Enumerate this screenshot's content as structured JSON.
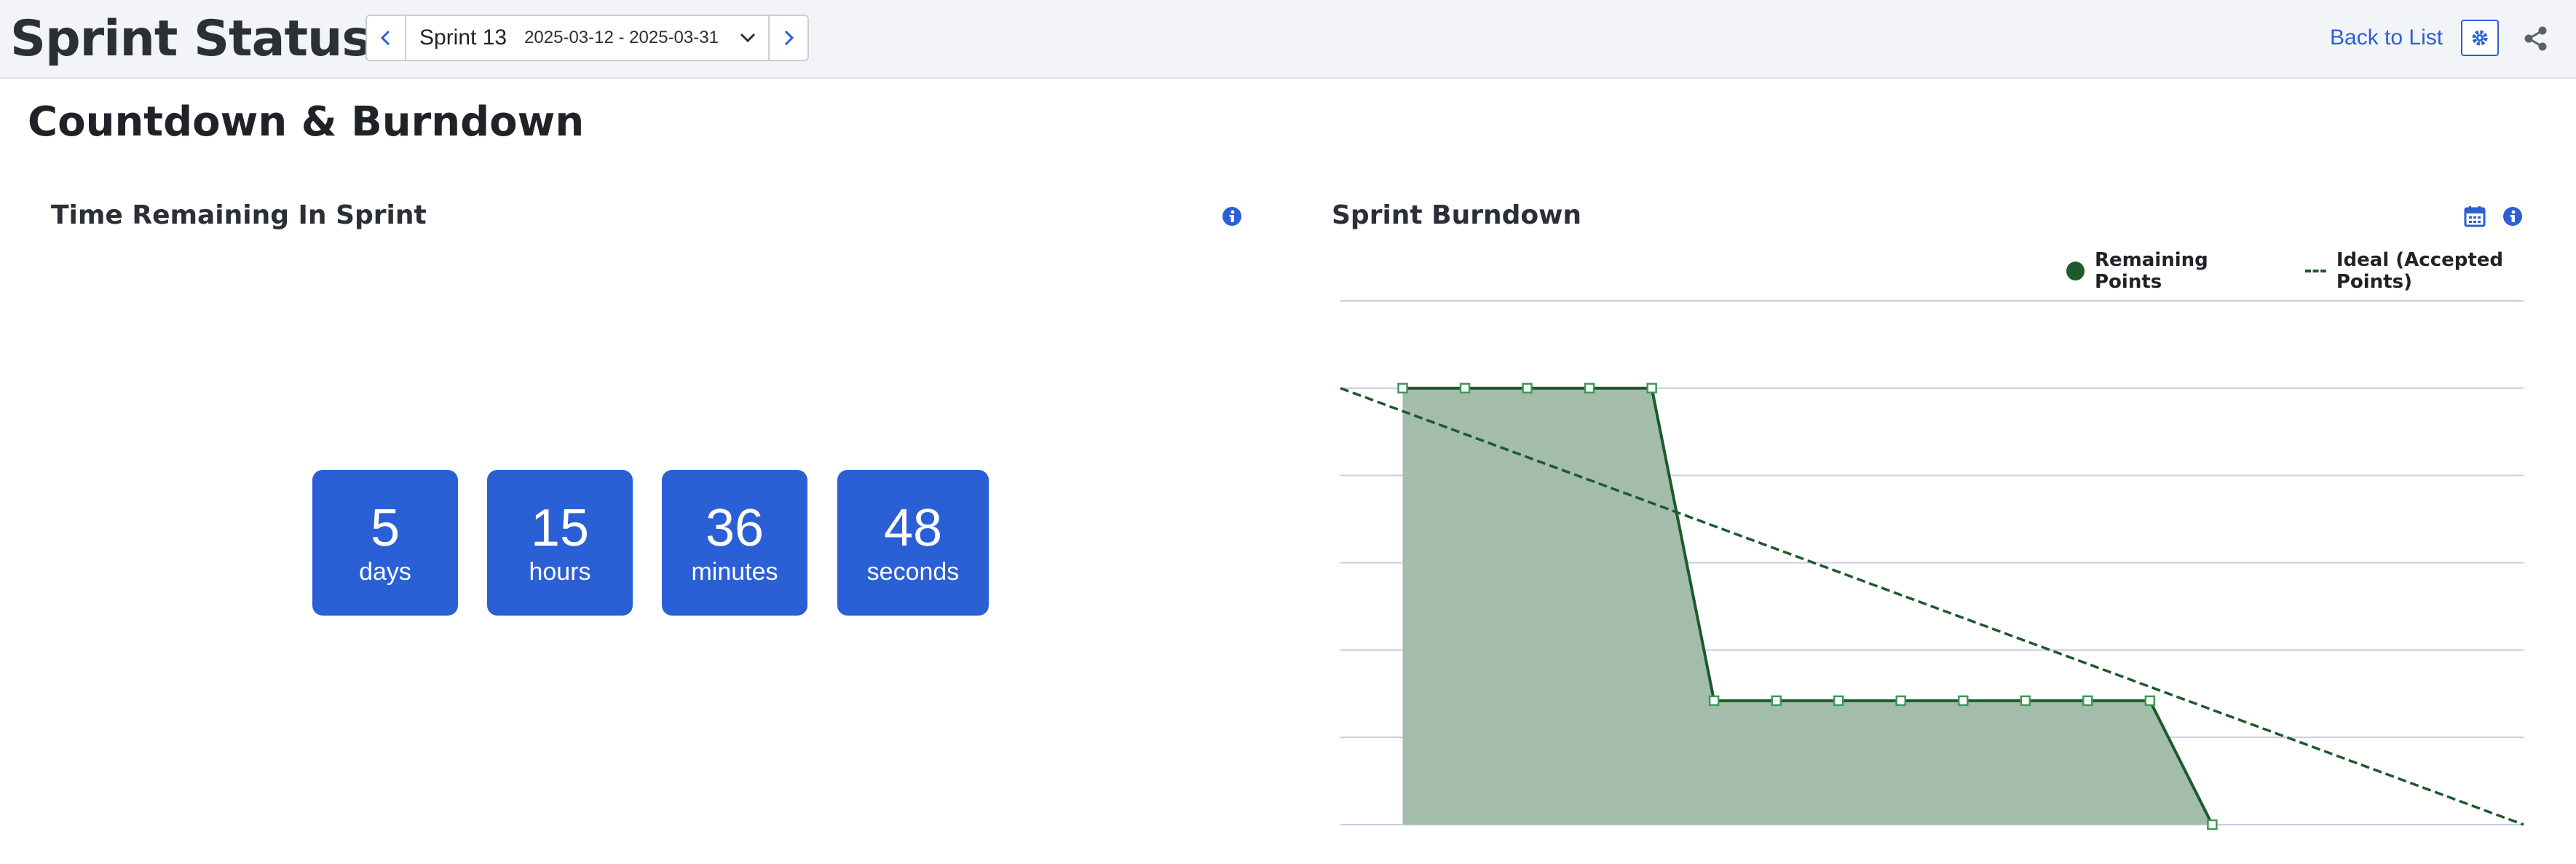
{
  "header": {
    "title": "Sprint Status",
    "sprint_name": "Sprint 13",
    "sprint_dates": "2025-03-12 - 2025-03-31",
    "back_link": "Back to List"
  },
  "section": {
    "title": "Countdown & Burndown"
  },
  "countdown": {
    "title": "Time Remaining In Sprint",
    "items": [
      {
        "value": "5",
        "unit": "days"
      },
      {
        "value": "15",
        "unit": "hours"
      },
      {
        "value": "36",
        "unit": "minutes"
      },
      {
        "value": "48",
        "unit": "seconds"
      }
    ]
  },
  "burndown": {
    "title": "Sprint Burndown",
    "legend": {
      "remaining": "Remaining Points",
      "ideal": "Ideal (Accepted Points)"
    }
  },
  "colors": {
    "accent": "#2a5fd6",
    "series_line": "#1d5a2c",
    "series_fill": "#a3bdaa",
    "grid": "#c8cde0"
  },
  "chart_data": {
    "type": "area",
    "title": "Sprint Burndown",
    "xlabel": "",
    "ylabel": "",
    "grid": true,
    "legend_position": "top-right",
    "x": [
      0,
      1,
      2,
      3,
      4,
      5,
      6,
      7,
      8,
      9,
      10,
      11,
      12,
      13,
      14,
      15,
      16,
      17,
      18,
      19
    ],
    "ylim": [
      0,
      6
    ],
    "series": [
      {
        "name": "Remaining Points",
        "x": [
          1,
          2,
          3,
          4,
          5,
          6,
          7,
          8,
          9,
          10,
          11,
          12,
          13,
          14
        ],
        "values": [
          5,
          5,
          5,
          5,
          5,
          1.42,
          1.42,
          1.42,
          1.42,
          1.42,
          1.42,
          1.42,
          1.42,
          0
        ]
      },
      {
        "name": "Ideal (Accepted Points)",
        "style": "dashed",
        "x": [
          0,
          19
        ],
        "values": [
          5,
          0
        ]
      }
    ]
  }
}
